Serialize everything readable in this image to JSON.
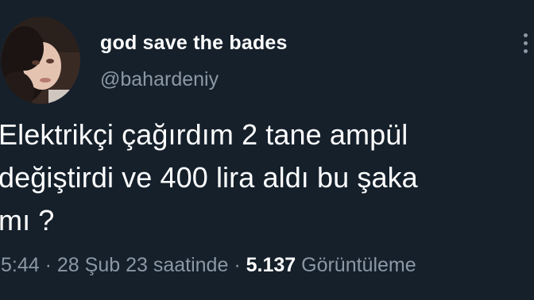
{
  "user": {
    "display_name": "god save the bades",
    "handle": "@bahardeniy"
  },
  "tweet": {
    "text": "Elektrikçi çağırdım 2 tane ampül\ndeğiştirdi ve 400 lira aldı bu şaka\nmı ?"
  },
  "meta": {
    "time": "5:44",
    "separator_1": "·",
    "date": "28 Şub 23 saatinde",
    "separator_2": "·",
    "views_count": "5.137",
    "views_label": "Görüntüleme"
  },
  "icons": {
    "avatar": "profile-photo",
    "more": "more-options-icon"
  },
  "colors": {
    "background": "#15202b",
    "primary_text": "#ffffff",
    "secondary_text": "#8b98a5"
  }
}
